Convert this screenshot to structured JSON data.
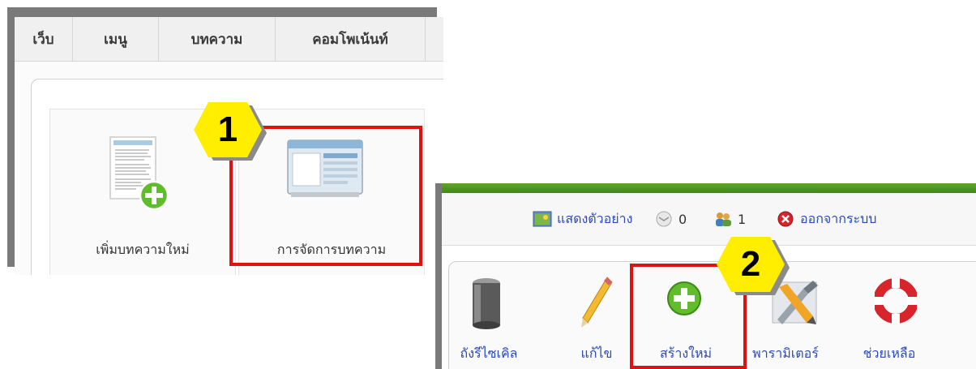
{
  "menu": {
    "items": [
      {
        "label": "เว็บ"
      },
      {
        "label": "เมนู"
      },
      {
        "label": "บทความ"
      },
      {
        "label": "คอมโพเน้นท์"
      }
    ]
  },
  "cpanel": {
    "tiles": [
      {
        "label": "เพิ่มบทความใหม่",
        "icon": "new-article-icon"
      },
      {
        "label": "การจัดการบทความ",
        "icon": "article-manager-icon"
      }
    ]
  },
  "badges": {
    "step1": "1",
    "step2": "2"
  },
  "status": {
    "preview_label": "แสดงตัวอย่าง",
    "messages_count": "0",
    "users_count": "1",
    "logout_label": "ออกจากระบบ"
  },
  "toolbar": {
    "trash_label": "ถังรีไซเคิล",
    "edit_label": "แก้ไข",
    "new_label": "สร้างใหม่",
    "params_label": "พารามิเตอร์",
    "help_label": "ช่วยเหลือ"
  },
  "colors": {
    "highlight": "#e01111",
    "badge_fill": "#ffee00",
    "green_bar": "#4e9a25",
    "link_blue": "#2a4bb8"
  }
}
